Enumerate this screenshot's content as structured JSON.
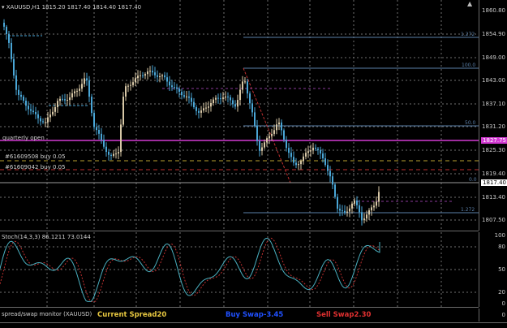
{
  "main": {
    "symbol_label": "XAUUSD,H1",
    "ohlc": [
      "1815.20",
      "1817.40",
      "1814.40",
      "1817.40"
    ],
    "price_ticks": [
      "1860.80",
      "1854.90",
      "1849.00",
      "1843.00",
      "1837.10",
      "1831.20",
      "1825.30",
      "1819.40",
      "1813.40",
      "1807.50"
    ],
    "current_price": "1817.40",
    "quarterly_price": "1827.75",
    "quarterly_label": "quarterly open",
    "orders": [
      "#61609508 buy 0.05",
      "#61609042 buy 0.05"
    ],
    "fib_levels": [
      "1.272",
      "100.0",
      "50.0",
      "0.0",
      "1.272"
    ],
    "colors": {
      "bull": "#d7c7a6",
      "bear": "#4aa6d6",
      "quarterly": "#d23ad2",
      "grid": "#6f6f6f",
      "fib": "#5a7fa8"
    }
  },
  "stoch": {
    "label": "Stoch(14,3,3) 86.1211 73.0144",
    "ticks": [
      "100",
      "80",
      "50",
      "20",
      "0"
    ]
  },
  "swap": {
    "label": "spread/swap monitor (XAUUSD)",
    "spread_label": "Current Spread",
    "spread_value": "20",
    "buy_label": "Buy Swap",
    "buy_value": "-3.45",
    "sell_label": "Sell Swap",
    "sell_value": "2.30",
    "ticks": [
      "0"
    ],
    "colors": {
      "spread": "#e8c840",
      "buy": "#2050ff",
      "sell": "#e03030"
    }
  }
}
